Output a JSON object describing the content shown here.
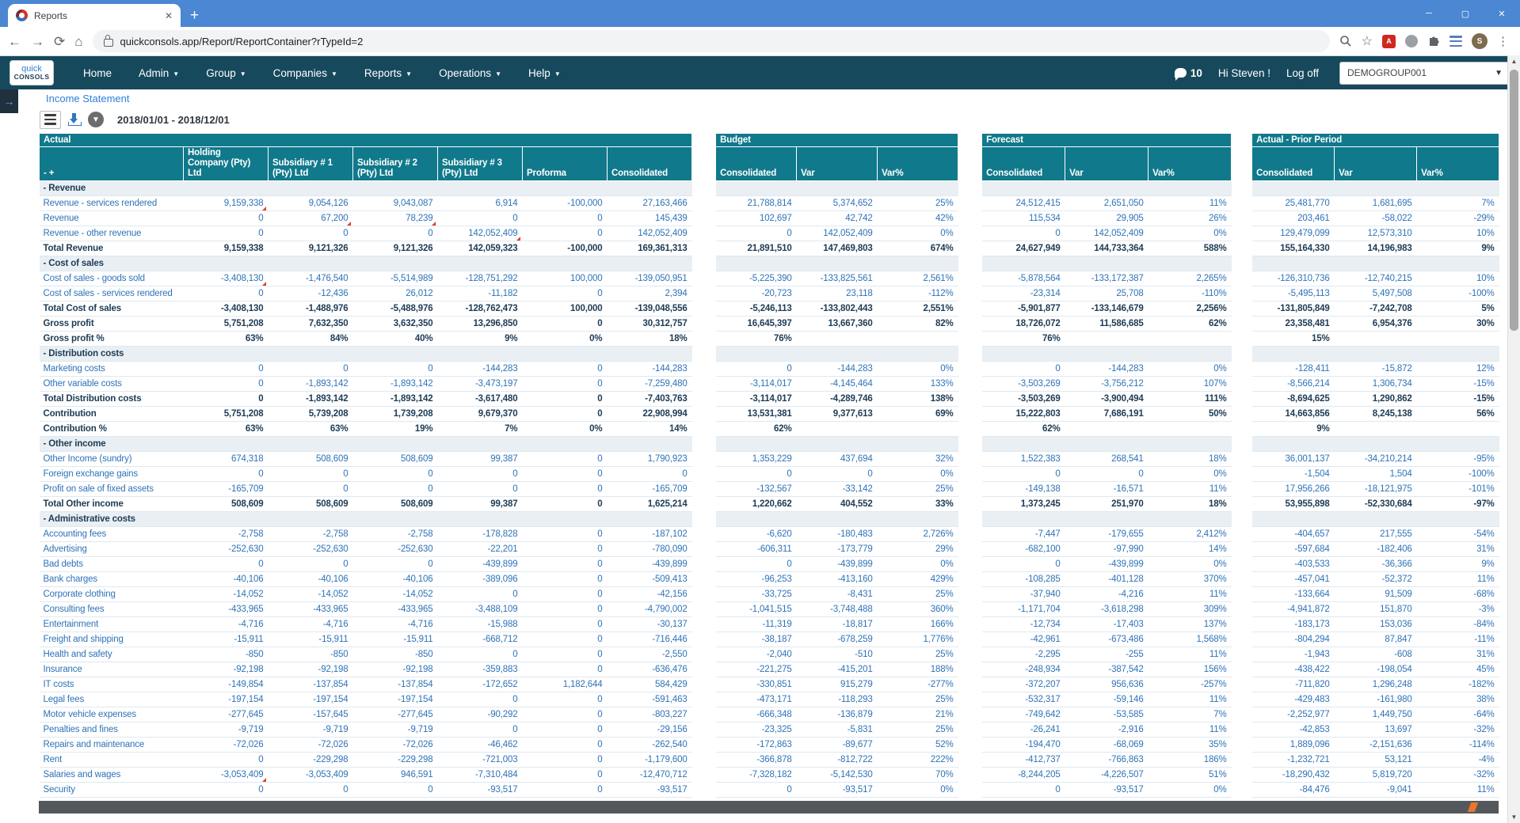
{
  "browser": {
    "tab_title": "Reports",
    "url": "quickconsols.app/Report/ReportContainer?rTypeId=2"
  },
  "navbar": {
    "logo_top": "quick",
    "logo_bottom": "CONSOLS",
    "items": [
      {
        "label": "Home",
        "caret": false
      },
      {
        "label": "Admin",
        "caret": true
      },
      {
        "label": "Group",
        "caret": true
      },
      {
        "label": "Companies",
        "caret": true
      },
      {
        "label": "Reports",
        "caret": true
      },
      {
        "label": "Operations",
        "caret": true
      },
      {
        "label": "Help",
        "caret": true
      }
    ],
    "chat_count": "10",
    "greeting": "Hi Steven !",
    "logoff_label": "Log off",
    "group_select_value": "DEMOGROUP001"
  },
  "report": {
    "title": "Income Statement",
    "date_range": "2018/01/01 - 2018/12/01"
  },
  "colors": {
    "chrome_blue": "#4b87d2",
    "nav_teal": "#17495d",
    "header_teal": "#10798b",
    "link_blue": "#2e73b8",
    "total_navy": "#1d3b55",
    "section_bg": "#e9eff3",
    "comment_flag_red": "#e23d2e",
    "hscrollbar_dark": "#54585c"
  },
  "table": {
    "groups": [
      {
        "label": "Actual",
        "cols": [
          "- +",
          "Holding Company (Pty) Ltd",
          "Subsidiary # 1 (Pty) Ltd",
          "Subsidiary # 2 (Pty) Ltd",
          "Subsidiary # 3 (Pty) Ltd",
          "Proforma",
          "Consolidated"
        ]
      },
      {
        "label": "Budget",
        "cols": [
          "Consolidated",
          "Var",
          "Var%"
        ]
      },
      {
        "label": "Forecast",
        "cols": [
          "Consolidated",
          "Var",
          "Var%"
        ]
      },
      {
        "label": "Actual - Prior Period",
        "cols": [
          "Consolidated",
          "Var",
          "Var%"
        ]
      }
    ],
    "rows": [
      {
        "label": "- Revenue",
        "type": "section"
      },
      {
        "label": "Revenue - services rendered",
        "type": "detail",
        "flags": [
          0
        ],
        "values": [
          "9,159,338",
          "9,054,126",
          "9,043,087",
          "6,914",
          "-100,000",
          "27,163,466",
          "21,788,814",
          "5,374,652",
          "25%",
          "24,512,415",
          "2,651,050",
          "11%",
          "25,481,770",
          "1,681,695",
          "7%"
        ]
      },
      {
        "label": "Revenue",
        "type": "detail",
        "flags": [
          1,
          2
        ],
        "values": [
          "0",
          "67,200",
          "78,239",
          "0",
          "0",
          "145,439",
          "102,697",
          "42,742",
          "42%",
          "115,534",
          "29,905",
          "26%",
          "203,461",
          "-58,022",
          "-29%"
        ]
      },
      {
        "label": "Revenue - other revenue",
        "type": "detail",
        "flags": [
          3
        ],
        "values": [
          "0",
          "0",
          "0",
          "142,052,409",
          "0",
          "142,052,409",
          "0",
          "142,052,409",
          "0%",
          "0",
          "142,052,409",
          "0%",
          "129,479,099",
          "12,573,310",
          "10%"
        ]
      },
      {
        "label": "Total Revenue",
        "type": "total",
        "values": [
          "9,159,338",
          "9,121,326",
          "9,121,326",
          "142,059,323",
          "-100,000",
          "169,361,313",
          "21,891,510",
          "147,469,803",
          "674%",
          "24,627,949",
          "144,733,364",
          "588%",
          "155,164,330",
          "14,196,983",
          "9%"
        ]
      },
      {
        "label": "- Cost of sales",
        "type": "section"
      },
      {
        "label": "Cost of sales - goods sold",
        "type": "detail",
        "flags": [
          0
        ],
        "values": [
          "-3,408,130",
          "-1,476,540",
          "-5,514,989",
          "-128,751,292",
          "100,000",
          "-139,050,951",
          "-5,225,390",
          "-133,825,561",
          "2,561%",
          "-5,878,564",
          "-133,172,387",
          "2,265%",
          "-126,310,736",
          "-12,740,215",
          "10%"
        ]
      },
      {
        "label": "Cost of sales - services rendered",
        "type": "detail",
        "values": [
          "0",
          "-12,436",
          "26,012",
          "-11,182",
          "0",
          "2,394",
          "-20,723",
          "23,118",
          "-112%",
          "-23,314",
          "25,708",
          "-110%",
          "-5,495,113",
          "5,497,508",
          "-100%"
        ]
      },
      {
        "label": "Total Cost of sales",
        "type": "total",
        "values": [
          "-3,408,130",
          "-1,488,976",
          "-5,488,976",
          "-128,762,473",
          "100,000",
          "-139,048,556",
          "-5,246,113",
          "-133,802,443",
          "2,551%",
          "-5,901,877",
          "-133,146,679",
          "2,256%",
          "-131,805,849",
          "-7,242,708",
          "5%"
        ]
      },
      {
        "label": "Gross profit",
        "type": "total",
        "values": [
          "5,751,208",
          "7,632,350",
          "3,632,350",
          "13,296,850",
          "0",
          "30,312,757",
          "16,645,397",
          "13,667,360",
          "82%",
          "18,726,072",
          "11,586,685",
          "62%",
          "23,358,481",
          "6,954,376",
          "30%"
        ]
      },
      {
        "label": "Gross profit %",
        "type": "pct",
        "values": [
          "63%",
          "84%",
          "40%",
          "9%",
          "0%",
          "18%",
          "76%",
          "",
          "",
          "76%",
          "",
          "",
          "15%",
          "",
          ""
        ]
      },
      {
        "label": "- Distribution costs",
        "type": "section"
      },
      {
        "label": "Marketing costs",
        "type": "detail",
        "values": [
          "0",
          "0",
          "0",
          "-144,283",
          "0",
          "-144,283",
          "0",
          "-144,283",
          "0%",
          "0",
          "-144,283",
          "0%",
          "-128,411",
          "-15,872",
          "12%"
        ]
      },
      {
        "label": "Other variable costs",
        "type": "detail",
        "values": [
          "0",
          "-1,893,142",
          "-1,893,142",
          "-3,473,197",
          "0",
          "-7,259,480",
          "-3,114,017",
          "-4,145,464",
          "133%",
          "-3,503,269",
          "-3,756,212",
          "107%",
          "-8,566,214",
          "1,306,734",
          "-15%"
        ]
      },
      {
        "label": "Total Distribution costs",
        "type": "total",
        "values": [
          "0",
          "-1,893,142",
          "-1,893,142",
          "-3,617,480",
          "0",
          "-7,403,763",
          "-3,114,017",
          "-4,289,746",
          "138%",
          "-3,503,269",
          "-3,900,494",
          "111%",
          "-8,694,625",
          "1,290,862",
          "-15%"
        ]
      },
      {
        "label": "Contribution",
        "type": "total",
        "values": [
          "5,751,208",
          "5,739,208",
          "1,739,208",
          "9,679,370",
          "0",
          "22,908,994",
          "13,531,381",
          "9,377,613",
          "69%",
          "15,222,803",
          "7,686,191",
          "50%",
          "14,663,856",
          "8,245,138",
          "56%"
        ]
      },
      {
        "label": "Contribution %",
        "type": "pct",
        "values": [
          "63%",
          "63%",
          "19%",
          "7%",
          "0%",
          "14%",
          "62%",
          "",
          "",
          "62%",
          "",
          "",
          "9%",
          "",
          ""
        ]
      },
      {
        "label": "- Other income",
        "type": "section"
      },
      {
        "label": "Other Income (sundry)",
        "type": "detail",
        "values": [
          "674,318",
          "508,609",
          "508,609",
          "99,387",
          "0",
          "1,790,923",
          "1,353,229",
          "437,694",
          "32%",
          "1,522,383",
          "268,541",
          "18%",
          "36,001,137",
          "-34,210,214",
          "-95%"
        ]
      },
      {
        "label": "Foreign exchange gains",
        "type": "detail",
        "values": [
          "0",
          "0",
          "0",
          "0",
          "0",
          "0",
          "0",
          "0",
          "0%",
          "0",
          "0",
          "0%",
          "-1,504",
          "1,504",
          "-100%"
        ]
      },
      {
        "label": "Profit on sale of fixed assets",
        "type": "detail",
        "values": [
          "-165,709",
          "0",
          "0",
          "0",
          "0",
          "-165,709",
          "-132,567",
          "-33,142",
          "25%",
          "-149,138",
          "-16,571",
          "11%",
          "17,956,266",
          "-18,121,975",
          "-101%"
        ]
      },
      {
        "label": "Total Other income",
        "type": "total",
        "values": [
          "508,609",
          "508,609",
          "508,609",
          "99,387",
          "0",
          "1,625,214",
          "1,220,662",
          "404,552",
          "33%",
          "1,373,245",
          "251,970",
          "18%",
          "53,955,898",
          "-52,330,684",
          "-97%"
        ]
      },
      {
        "label": "- Administrative costs",
        "type": "section"
      },
      {
        "label": "Accounting fees",
        "type": "detail",
        "values": [
          "-2,758",
          "-2,758",
          "-2,758",
          "-178,828",
          "0",
          "-187,102",
          "-6,620",
          "-180,483",
          "2,726%",
          "-7,447",
          "-179,655",
          "2,412%",
          "-404,657",
          "217,555",
          "-54%"
        ]
      },
      {
        "label": "Advertising",
        "type": "detail",
        "values": [
          "-252,630",
          "-252,630",
          "-252,630",
          "-22,201",
          "0",
          "-780,090",
          "-606,311",
          "-173,779",
          "29%",
          "-682,100",
          "-97,990",
          "14%",
          "-597,684",
          "-182,406",
          "31%"
        ]
      },
      {
        "label": "Bad debts",
        "type": "detail",
        "values": [
          "0",
          "0",
          "0",
          "-439,899",
          "0",
          "-439,899",
          "0",
          "-439,899",
          "0%",
          "0",
          "-439,899",
          "0%",
          "-403,533",
          "-36,366",
          "9%"
        ]
      },
      {
        "label": "Bank charges",
        "type": "detail",
        "values": [
          "-40,106",
          "-40,106",
          "-40,106",
          "-389,096",
          "0",
          "-509,413",
          "-96,253",
          "-413,160",
          "429%",
          "-108,285",
          "-401,128",
          "370%",
          "-457,041",
          "-52,372",
          "11%"
        ]
      },
      {
        "label": "Corporate clothing",
        "type": "detail",
        "values": [
          "-14,052",
          "-14,052",
          "-14,052",
          "0",
          "0",
          "-42,156",
          "-33,725",
          "-8,431",
          "25%",
          "-37,940",
          "-4,216",
          "11%",
          "-133,664",
          "91,509",
          "-68%"
        ]
      },
      {
        "label": "Consulting fees",
        "type": "detail",
        "values": [
          "-433,965",
          "-433,965",
          "-433,965",
          "-3,488,109",
          "0",
          "-4,790,002",
          "-1,041,515",
          "-3,748,488",
          "360%",
          "-1,171,704",
          "-3,618,298",
          "309%",
          "-4,941,872",
          "151,870",
          "-3%"
        ]
      },
      {
        "label": "Entertainment",
        "type": "detail",
        "values": [
          "-4,716",
          "-4,716",
          "-4,716",
          "-15,988",
          "0",
          "-30,137",
          "-11,319",
          "-18,817",
          "166%",
          "-12,734",
          "-17,403",
          "137%",
          "-183,173",
          "153,036",
          "-84%"
        ]
      },
      {
        "label": "Freight and shipping",
        "type": "detail",
        "values": [
          "-15,911",
          "-15,911",
          "-15,911",
          "-668,712",
          "0",
          "-716,446",
          "-38,187",
          "-678,259",
          "1,776%",
          "-42,961",
          "-673,486",
          "1,568%",
          "-804,294",
          "87,847",
          "-11%"
        ]
      },
      {
        "label": "Health and safety",
        "type": "detail",
        "values": [
          "-850",
          "-850",
          "-850",
          "0",
          "0",
          "-2,550",
          "-2,040",
          "-510",
          "25%",
          "-2,295",
          "-255",
          "11%",
          "-1,943",
          "-608",
          "31%"
        ]
      },
      {
        "label": "Insurance",
        "type": "detail",
        "values": [
          "-92,198",
          "-92,198",
          "-92,198",
          "-359,883",
          "0",
          "-636,476",
          "-221,275",
          "-415,201",
          "188%",
          "-248,934",
          "-387,542",
          "156%",
          "-438,422",
          "-198,054",
          "45%"
        ]
      },
      {
        "label": "IT costs",
        "type": "detail",
        "values": [
          "-149,854",
          "-137,854",
          "-137,854",
          "-172,652",
          "1,182,644",
          "584,429",
          "-330,851",
          "915,279",
          "-277%",
          "-372,207",
          "956,636",
          "-257%",
          "-711,820",
          "1,296,248",
          "-182%"
        ]
      },
      {
        "label": "Legal fees",
        "type": "detail",
        "values": [
          "-197,154",
          "-197,154",
          "-197,154",
          "0",
          "0",
          "-591,463",
          "-473,171",
          "-118,293",
          "25%",
          "-532,317",
          "-59,146",
          "11%",
          "-429,483",
          "-161,980",
          "38%"
        ]
      },
      {
        "label": "Motor vehicle expenses",
        "type": "detail",
        "values": [
          "-277,645",
          "-157,645",
          "-277,645",
          "-90,292",
          "0",
          "-803,227",
          "-666,348",
          "-136,879",
          "21%",
          "-749,642",
          "-53,585",
          "7%",
          "-2,252,977",
          "1,449,750",
          "-64%"
        ]
      },
      {
        "label": "Penalties and fines",
        "type": "detail",
        "values": [
          "-9,719",
          "-9,719",
          "-9,719",
          "0",
          "0",
          "-29,156",
          "-23,325",
          "-5,831",
          "25%",
          "-26,241",
          "-2,916",
          "11%",
          "-42,853",
          "13,697",
          "-32%"
        ]
      },
      {
        "label": "Repairs and maintenance",
        "type": "detail",
        "values": [
          "-72,026",
          "-72,026",
          "-72,026",
          "-46,462",
          "0",
          "-262,540",
          "-172,863",
          "-89,677",
          "52%",
          "-194,470",
          "-68,069",
          "35%",
          "1,889,096",
          "-2,151,636",
          "-114%"
        ]
      },
      {
        "label": "Rent",
        "type": "detail",
        "values": [
          "0",
          "-229,298",
          "-229,298",
          "-721,003",
          "0",
          "-1,179,600",
          "-366,878",
          "-812,722",
          "222%",
          "-412,737",
          "-766,863",
          "186%",
          "-1,232,721",
          "53,121",
          "-4%"
        ]
      },
      {
        "label": "Salaries and wages",
        "type": "detail",
        "flags": [
          0
        ],
        "values": [
          "-3,053,409",
          "-3,053,409",
          "946,591",
          "-7,310,484",
          "0",
          "-12,470,712",
          "-7,328,182",
          "-5,142,530",
          "70%",
          "-8,244,205",
          "-4,226,507",
          "51%",
          "-18,290,432",
          "5,819,720",
          "-32%"
        ]
      },
      {
        "label": "Security",
        "type": "detail",
        "values": [
          "0",
          "0",
          "0",
          "-93,517",
          "0",
          "-93,517",
          "0",
          "-93,517",
          "0%",
          "0",
          "-93,517",
          "0%",
          "-84,476",
          "-9,041",
          "11%"
        ]
      }
    ]
  }
}
